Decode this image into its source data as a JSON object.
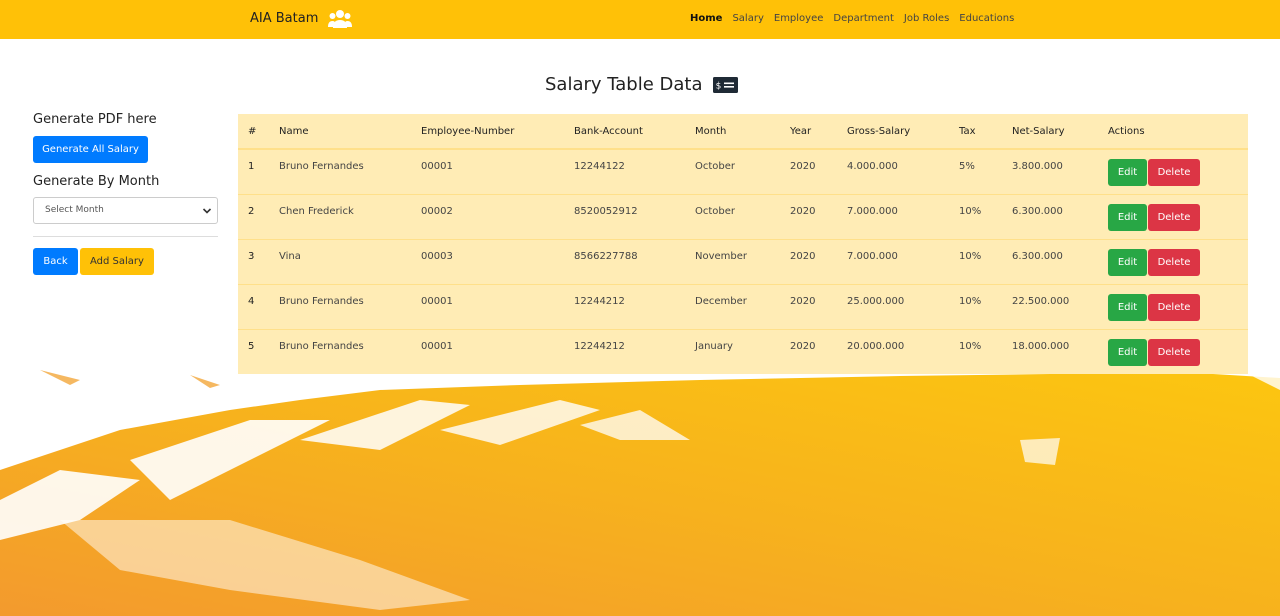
{
  "navbar": {
    "brand": "AIA Batam",
    "brand_icon": "users-icon",
    "links": [
      "Home",
      "Salary",
      "Employee",
      "Department",
      "Job Roles",
      "Educations"
    ],
    "active": "Home",
    "color": "#ffc107"
  },
  "page": {
    "title": "Salary Table Data",
    "title_icon": "money-bill-icon"
  },
  "sidebar": {
    "pdf_heading": "Generate PDF here",
    "generate_all_label": "Generate All Salary",
    "month_heading": "Generate By Month",
    "select_placeholder": "Select Month",
    "back_label": "Back",
    "add_label": "Add Salary"
  },
  "table": {
    "headers": [
      "#",
      "Name",
      "Employee-Number",
      "Bank-Account",
      "Month",
      "Year",
      "Gross-Salary",
      "Tax",
      "Net-Salary",
      "Actions"
    ],
    "rows": [
      {
        "no": "1",
        "name": "Bruno Fernandes",
        "emp": "00001",
        "bank": "12244122",
        "month": "October",
        "year": "2020",
        "gross": "4.000.000",
        "tax": "5%",
        "net": "3.800.000"
      },
      {
        "no": "2",
        "name": "Chen Frederick",
        "emp": "00002",
        "bank": "8520052912",
        "month": "October",
        "year": "2020",
        "gross": "7.000.000",
        "tax": "10%",
        "net": "6.300.000"
      },
      {
        "no": "3",
        "name": "Vina",
        "emp": "00003",
        "bank": "8566227788",
        "month": "November",
        "year": "2020",
        "gross": "7.000.000",
        "tax": "10%",
        "net": "6.300.000"
      },
      {
        "no": "4",
        "name": "Bruno Fernandes",
        "emp": "00001",
        "bank": "12244212",
        "month": "December",
        "year": "2020",
        "gross": "25.000.000",
        "tax": "10%",
        "net": "22.500.000"
      },
      {
        "no": "5",
        "name": "Bruno Fernandes",
        "emp": "00001",
        "bank": "12244212",
        "month": "January",
        "year": "2020",
        "gross": "20.000.000",
        "tax": "10%",
        "net": "18.000.000"
      }
    ],
    "edit_label": "Edit",
    "delete_label": "Delete"
  },
  "colors": {
    "primary": "#007bff",
    "warning": "#ffc107",
    "success": "#28a745",
    "danger": "#dc3545",
    "table_bg": "#ffecb5"
  }
}
